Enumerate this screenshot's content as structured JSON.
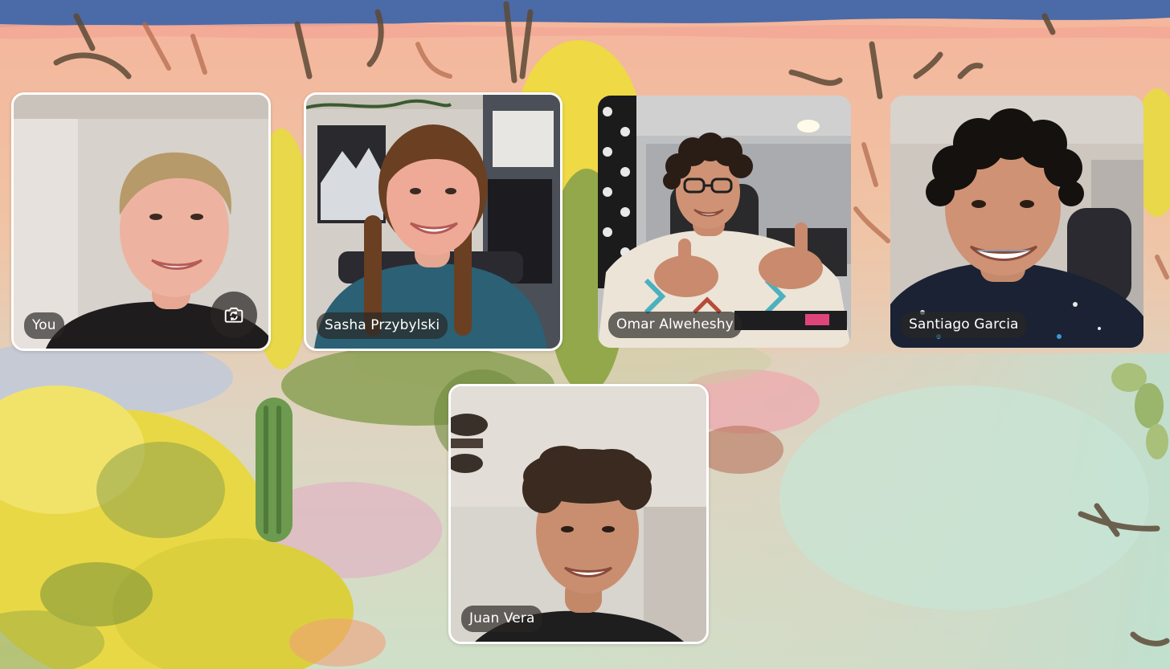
{
  "call": {
    "participants": [
      {
        "name": "You",
        "is_self": true,
        "control": {
          "icon": "camera-flip-icon"
        }
      },
      {
        "name": "Sasha Przybylski"
      },
      {
        "name": "Omar Alweheshy"
      },
      {
        "name": "Santiago Garcia"
      },
      {
        "name": "Juan Vera"
      }
    ]
  },
  "theme": {
    "backdrop": "painted desert illustration",
    "tile_border": "#ffffff",
    "pill_background": "#28262480",
    "pill_text": "#ffffff",
    "sky": "#4b6aa8",
    "sand": "#f2b9a0",
    "foliage": "#e8d640"
  }
}
